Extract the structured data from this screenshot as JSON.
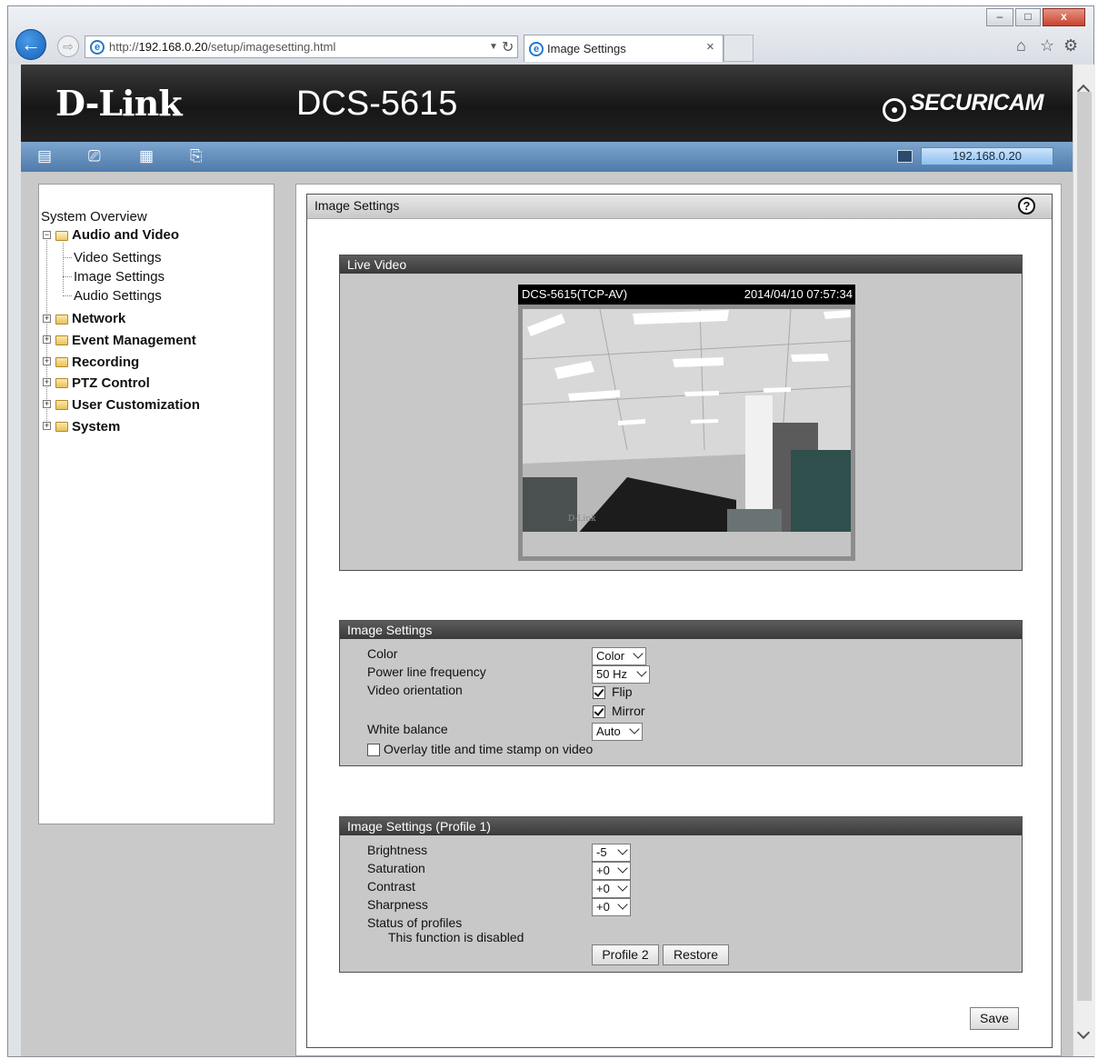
{
  "browser": {
    "url_prefix": "http://",
    "url_host": "192.168.0.20",
    "url_path": "/setup/imagesetting.html",
    "tab_title": "Image Settings",
    "tab_close": "×",
    "window_controls": {
      "minimize": "–",
      "maximize": "□",
      "close": "x"
    }
  },
  "header": {
    "logo": "D-Link",
    "model": "DCS-5615",
    "brand": "SECURICAM",
    "ip": "192.168.0.20"
  },
  "sidebar": {
    "overview": "System Overview",
    "audio_video": "Audio and Video",
    "children": [
      "Video Settings",
      "Image Settings",
      "Audio Settings"
    ],
    "groups": [
      "Network",
      "Event Management",
      "Recording",
      "PTZ Control",
      "User Customization",
      "System"
    ]
  },
  "main": {
    "title": "Image Settings",
    "help": "?",
    "live_video": {
      "title": "Live Video",
      "camera_name": "DCS-5615(TCP-AV)",
      "timestamp": "2014/04/10 07:57:34",
      "brand_on_box": "D-Link"
    },
    "image_settings": {
      "title": "Image Settings",
      "color_label": "Color",
      "color_value": "Color",
      "power_label": "Power line frequency",
      "power_value": "50 Hz",
      "orientation_label": "Video orientation",
      "flip_label": "Flip",
      "flip_checked": true,
      "mirror_label": "Mirror",
      "mirror_checked": true,
      "wb_label": "White balance",
      "wb_value": "Auto",
      "overlay_label": "Overlay title and time stamp on video",
      "overlay_checked": false
    },
    "profile": {
      "title": "Image Settings (Profile 1)",
      "brightness_label": "Brightness",
      "brightness_value": "-5",
      "saturation_label": "Saturation",
      "saturation_value": "+0",
      "contrast_label": "Contrast",
      "contrast_value": "+0",
      "sharpness_label": "Sharpness",
      "sharpness_value": "+0",
      "status_label": "Status of profiles",
      "status_text": "This function is disabled",
      "profile2_button": "Profile 2",
      "restore_button": "Restore"
    },
    "save_button": "Save"
  },
  "colors": {
    "header_bg": "#1e1e1e",
    "navbar": "#5f8bbb",
    "section_head": "#444444",
    "section_body": "#c8c8c8",
    "page_bg": "#c9c9c9"
  }
}
